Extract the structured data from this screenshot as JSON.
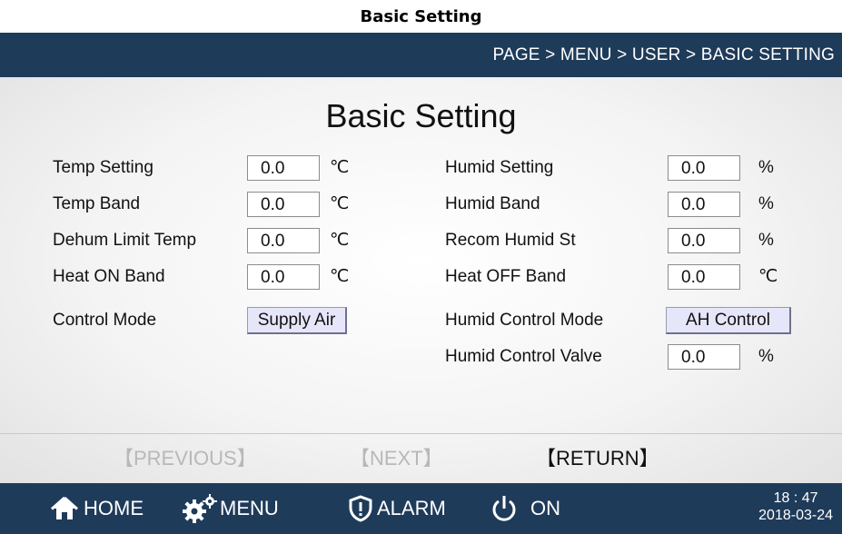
{
  "caption": "Basic Setting",
  "header": {
    "breadcrumb": "PAGE > MENU > USER > BASIC SETTING"
  },
  "main": {
    "title": "Basic Setting",
    "left": [
      {
        "label": "Temp Setting",
        "value": "0.0",
        "unit": "℃"
      },
      {
        "label": "Temp Band",
        "value": "0.0",
        "unit": "℃"
      },
      {
        "label": "Dehum Limit Temp",
        "value": "0.0",
        "unit": "℃"
      },
      {
        "label": "Heat ON Band",
        "value": "0.0",
        "unit": "℃"
      }
    ],
    "control_mode": {
      "label": "Control Mode",
      "value": "Supply Air"
    },
    "right": [
      {
        "label": "Humid Setting",
        "value": "0.0",
        "unit": "%"
      },
      {
        "label": "Humid Band",
        "value": "0.0",
        "unit": "%"
      },
      {
        "label": "Recom Humid St",
        "value": "0.0",
        "unit": "%"
      },
      {
        "label": "Heat OFF Band",
        "value": "0.0",
        "unit": "℃"
      }
    ],
    "humid_control_mode": {
      "label": "Humid Control Mode",
      "value": "AH Control"
    },
    "humid_control_valve": {
      "label": "Humid Control Valve",
      "value": "0.0",
      "unit": "%"
    }
  },
  "nav": {
    "previous": "【PREVIOUS】",
    "next": "【NEXT】",
    "return": "【RETURN】"
  },
  "bottombar": {
    "home": "HOME",
    "menu": "MENU",
    "alarm": "ALARM",
    "power": "ON",
    "time": "18 : 47",
    "date": "2018-03-24",
    "icons": {
      "home": "home-icon",
      "menu": "gears-icon",
      "alarm": "shield-alert-icon",
      "power": "power-icon"
    }
  },
  "colors": {
    "bar": "#1f3b5a",
    "button": "#e6e6fa",
    "dim_nav": "#b8b8b8"
  }
}
